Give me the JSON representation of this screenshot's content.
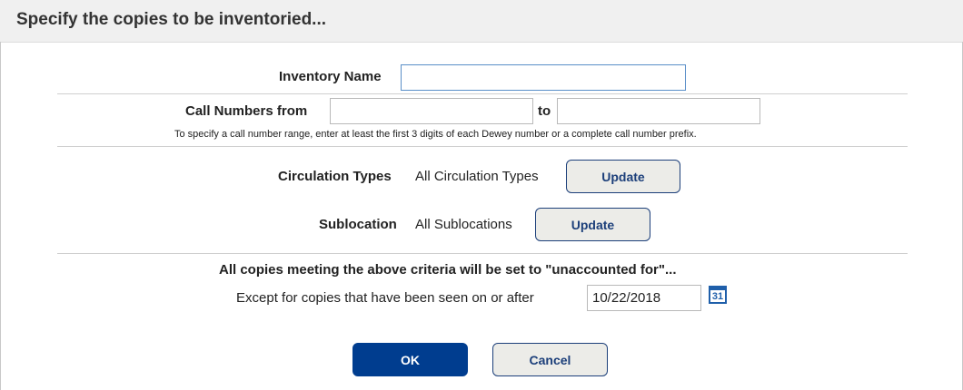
{
  "header": {
    "title": "Specify the copies to be inventoried..."
  },
  "inventory": {
    "label": "Inventory Name",
    "value": ""
  },
  "call_numbers": {
    "label": "Call Numbers from",
    "from_value": "",
    "to_label": "to",
    "to_value": "",
    "hint": "To specify a call number range, enter at least the first 3 digits of each Dewey number or a complete call number prefix."
  },
  "circulation": {
    "label": "Circulation Types",
    "value": "All Circulation Types",
    "button": "Update"
  },
  "sublocation": {
    "label": "Sublocation",
    "value": "All Sublocations",
    "button": "Update"
  },
  "criteria": {
    "notice": "All copies meeting the above criteria will be set to \"unaccounted for\"...",
    "except_label": "Except for copies that have been seen on or after",
    "date_value": "10/22/2018",
    "calendar_icon": "calendar-icon",
    "calendar_day": "31"
  },
  "actions": {
    "ok": "OK",
    "cancel": "Cancel"
  },
  "colors": {
    "primary": "#003d8f",
    "secondary_bg": "#ecece8",
    "accent": "#1f5faa"
  }
}
